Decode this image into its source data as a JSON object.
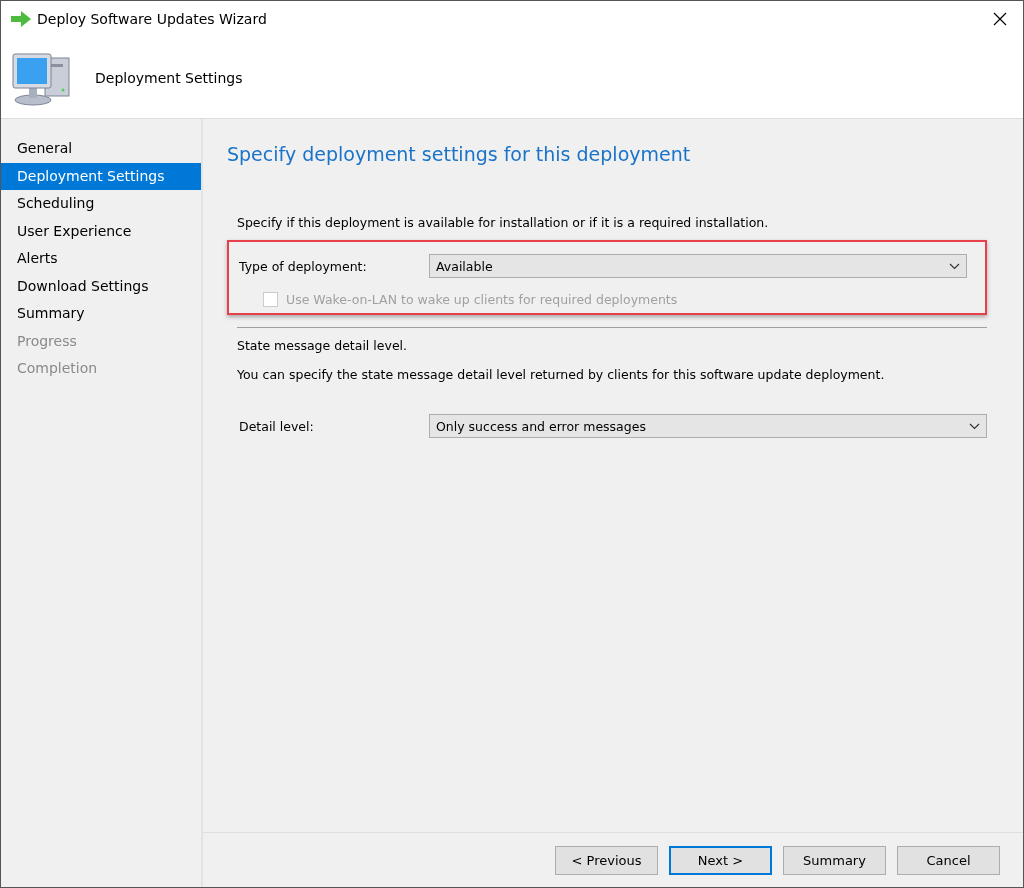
{
  "window": {
    "title": "Deploy Software Updates Wizard"
  },
  "header": {
    "title": "Deployment Settings"
  },
  "sidebar": {
    "items": [
      {
        "label": "General",
        "selected": false,
        "disabled": false
      },
      {
        "label": "Deployment Settings",
        "selected": true,
        "disabled": false
      },
      {
        "label": "Scheduling",
        "selected": false,
        "disabled": false
      },
      {
        "label": "User Experience",
        "selected": false,
        "disabled": false
      },
      {
        "label": "Alerts",
        "selected": false,
        "disabled": false
      },
      {
        "label": "Download Settings",
        "selected": false,
        "disabled": false
      },
      {
        "label": "Summary",
        "selected": false,
        "disabled": false
      },
      {
        "label": "Progress",
        "selected": false,
        "disabled": true
      },
      {
        "label": "Completion",
        "selected": false,
        "disabled": true
      }
    ]
  },
  "content": {
    "heading": "Specify deployment settings for this deployment",
    "intro": "Specify if this deployment is available for installation or if it is a required installation.",
    "deployment_type": {
      "label": "Type of deployment:",
      "value": "Available",
      "highlighted": true
    },
    "wake_on_lan": {
      "label": "Use Wake-on-LAN to wake up clients for required deployments",
      "checked": false,
      "disabled": true
    },
    "state_section": "State message detail level.",
    "state_description": "You can specify the state message detail level returned by clients for this software update deployment.",
    "detail_level": {
      "label": "Detail level:",
      "value": "Only success and error messages"
    }
  },
  "buttons": [
    {
      "label": "< Previous",
      "default": false
    },
    {
      "label": "Next >",
      "default": true
    },
    {
      "label": "Summary",
      "default": false
    },
    {
      "label": "Cancel",
      "default": false
    }
  ]
}
